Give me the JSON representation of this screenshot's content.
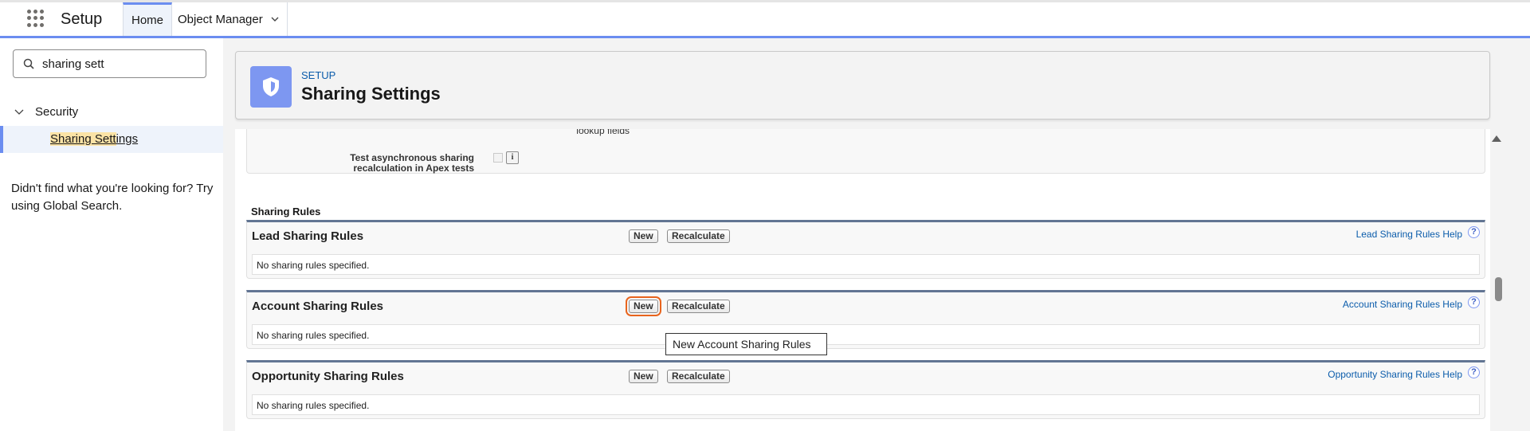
{
  "header": {
    "app_name": "Setup",
    "tabs": [
      {
        "label": "Home"
      },
      {
        "label": "Object Manager"
      }
    ]
  },
  "sidebar": {
    "search": {
      "value": "sharing sett"
    },
    "tree": {
      "section": "Security",
      "item_hl": "Sharing Sett",
      "item_rest": "ings"
    },
    "help_text": "Didn't find what you're looking for? Try using Global Search."
  },
  "page_header": {
    "breadcrumb": "SETUP",
    "title": "Sharing Settings"
  },
  "settings": {
    "fragment_text": "lookup fields",
    "test_label": "Test asynchronous sharing recalculation in Apex tests",
    "info_glyph": "i"
  },
  "sharing_rules": {
    "heading": "Sharing Rules",
    "new_label": "New",
    "recalc_label": "Recalculate",
    "empty_text": "No sharing rules specified.",
    "sections": [
      {
        "title": "Lead Sharing Rules",
        "help": "Lead Sharing Rules Help"
      },
      {
        "title": "Account Sharing Rules",
        "help": "Account Sharing Rules Help"
      },
      {
        "title": "Opportunity Sharing Rules",
        "help": "Opportunity Sharing Rules Help"
      }
    ]
  },
  "tooltip": "New Account Sharing Rules",
  "icons": {
    "help_glyph": "?"
  },
  "colors": {
    "brand": "#6b8df0",
    "link": "#0b5cab",
    "focus": "#e8641d"
  }
}
